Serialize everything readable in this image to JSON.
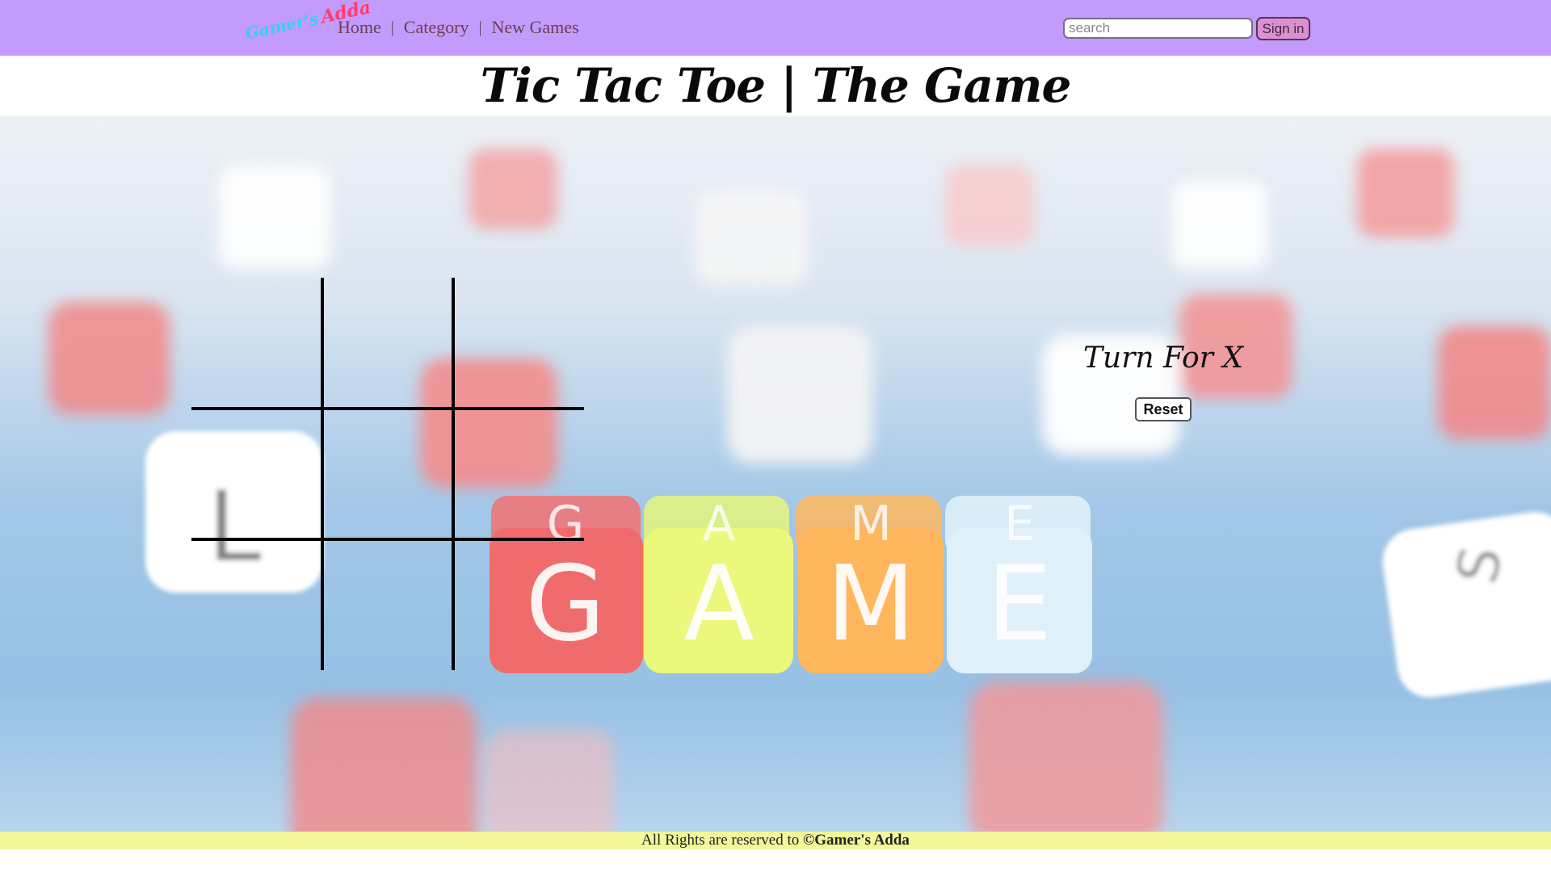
{
  "navbar": {
    "logo": {
      "part1": "Gamer's",
      "part2": "Adda"
    },
    "links": [
      "Home",
      "Category",
      "New Games"
    ],
    "separator": "|",
    "search": {
      "placeholder": "search",
      "value": ""
    },
    "signin_label": "Sign in",
    "background": "#c39bfc"
  },
  "page": {
    "title": "Tic Tac Toe | The Game"
  },
  "game": {
    "board": [
      [
        "",
        "",
        ""
      ],
      [
        "",
        "",
        ""
      ],
      [
        "",
        "",
        ""
      ]
    ],
    "turn_text": "Turn For X",
    "reset_label": "Reset",
    "background_art": "game-letter-dice-image"
  },
  "footer": {
    "text": "All Rights are reserved to ",
    "brand": "©Gamer's Adda",
    "background": "#f3f79a"
  }
}
